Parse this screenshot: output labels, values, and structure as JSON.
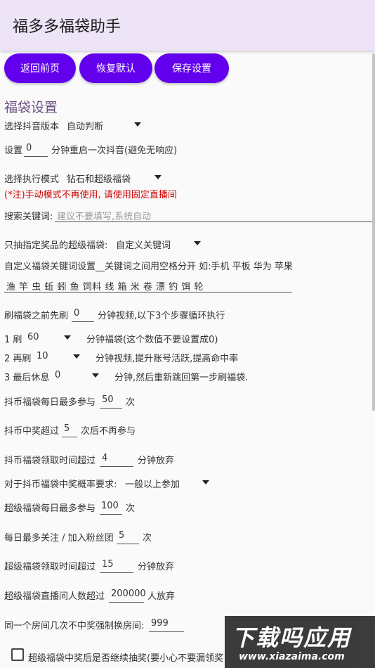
{
  "app": {
    "title": "福多多福袋助手"
  },
  "buttons": {
    "back": "返回前页",
    "reset": "恢复默认",
    "save": "保存设置"
  },
  "section_title": "福袋设置",
  "douyin_version": {
    "label": "选择抖音版本",
    "value": "自动判断"
  },
  "restart": {
    "prefix": "设置",
    "value": "0",
    "suffix": "分钟重启一次抖音(避免无响应)"
  },
  "exec_mode": {
    "label": "选择执行模式",
    "value": "钻石和超级福袋"
  },
  "note": "(*注)手动模式不再使用, 请使用固定直播间",
  "search": {
    "label": "搜索关键词:",
    "placeholder": "建议不要填写,系统自动"
  },
  "prize_filter": {
    "label": "只抽指定奖品的超级福袋:",
    "value": "自定义关键词"
  },
  "keyword_setting": {
    "label": "自定义福袋关键词设置__关键词之间用空格分开 如:手机 平板 华为 苹果",
    "value": "渔 竿 虫 蚯 蚓 鱼 饲料 线 箱 米 卷 漂 钓 饵 轮"
  },
  "pre_video": {
    "prefix": "刷福袋之前先刷",
    "value": "0",
    "suffix": "分钟视频,以下3个步骤循环执行"
  },
  "step1": {
    "label": "1 刷",
    "value": "60",
    "suffix": "分钟福袋(这个数值不要设置成0)"
  },
  "step2": {
    "label": "2 再刷",
    "value": "10",
    "suffix": "分钟视频,提升账号活跃,提高命中率"
  },
  "step3": {
    "label": "3 最后休息",
    "value": "0",
    "suffix": "分钟,然后重新跳回第一步刷福袋."
  },
  "coin_daily": {
    "prefix": "抖币福袋每日最多参与",
    "value": "50",
    "suffix": "次"
  },
  "coin_win": {
    "prefix": "抖币中奖超过",
    "value": "5",
    "suffix": "次后不再参与"
  },
  "coin_timeout": {
    "prefix": "抖币福袋领取时间超过",
    "value": "4",
    "suffix": "分钟放弃"
  },
  "coin_prob": {
    "label": "对于抖币福袋中奖概率要求:",
    "value": "一般以上参加"
  },
  "super_daily": {
    "prefix": "超级福袋每日最多参与",
    "value": "100",
    "suffix": "次"
  },
  "follow_daily": {
    "prefix": "每日最多关注 / 加入粉丝团",
    "value": "5",
    "suffix": "次"
  },
  "super_timeout": {
    "prefix": "超级福袋领取时间超过",
    "value": "15",
    "suffix": "分钟放弃"
  },
  "super_room": {
    "prefix": "超级福袋直播间人数超过",
    "value": "200000",
    "suffix": "人放弃"
  },
  "room_switch": {
    "label": "同一个房间几次不中奖强制换房间:",
    "value": "999"
  },
  "continue_after_win": {
    "label": "超级福袋中奖后是否继续抽奖(要小心不要漏领奖"
  },
  "watermark": {
    "big": "下载吗应用",
    "small": "www.xiazaima.com"
  }
}
